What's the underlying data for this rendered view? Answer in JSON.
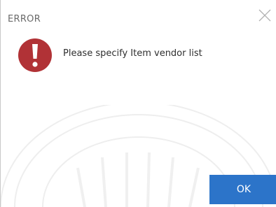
{
  "dialog": {
    "title": "ERROR",
    "message": "Please specify Item vendor list",
    "ok_label": "OK",
    "icon": "error-exclamation-icon",
    "close_icon": "close-icon"
  },
  "colors": {
    "error_icon": "#b13236",
    "accent": "#2c74c9",
    "title_text": "#6a6a6a",
    "message_text": "#2f2f2f"
  }
}
